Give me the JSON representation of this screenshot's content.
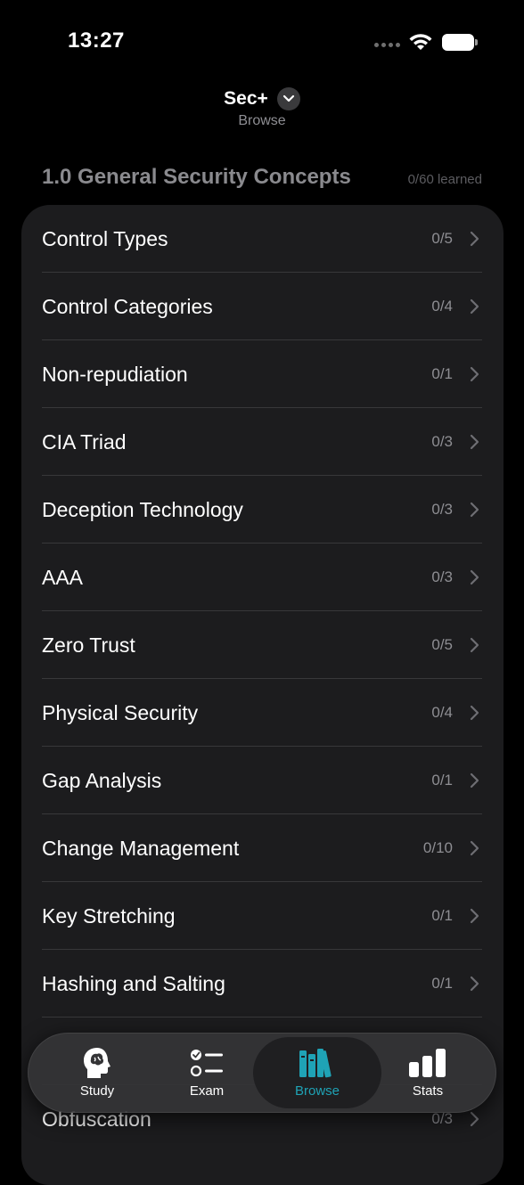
{
  "status": {
    "time": "13:27"
  },
  "header": {
    "title": "Sec+",
    "subtitle": "Browse"
  },
  "section": {
    "title": "1.0 General Security Concepts",
    "progress": "0/60 learned"
  },
  "rows": [
    {
      "label": "Control Types",
      "count": "0/5"
    },
    {
      "label": "Control Categories",
      "count": "0/4"
    },
    {
      "label": "Non-repudiation",
      "count": "0/1"
    },
    {
      "label": "CIA Triad",
      "count": "0/3"
    },
    {
      "label": "Deception Technology",
      "count": "0/3"
    },
    {
      "label": "AAA",
      "count": "0/3"
    },
    {
      "label": "Zero Trust",
      "count": "0/5"
    },
    {
      "label": "Physical Security",
      "count": "0/4"
    },
    {
      "label": "Gap Analysis",
      "count": "0/1"
    },
    {
      "label": "Change Management",
      "count": "0/10"
    },
    {
      "label": "Key Stretching",
      "count": "0/1"
    },
    {
      "label": "Hashing and Salting",
      "count": "0/1"
    },
    {
      "label": "",
      "count": ""
    },
    {
      "label": "Obfuscation",
      "count": "0/3"
    }
  ],
  "tabs": [
    {
      "label": "Study",
      "icon": "brain-head-icon"
    },
    {
      "label": "Exam",
      "icon": "checklist-icon"
    },
    {
      "label": "Browse",
      "icon": "books-icon",
      "active": true
    },
    {
      "label": "Stats",
      "icon": "bar-chart-icon"
    }
  ],
  "colors": {
    "accent": "#1fa3b6",
    "background": "#000000",
    "card": "#1c1c1e"
  }
}
